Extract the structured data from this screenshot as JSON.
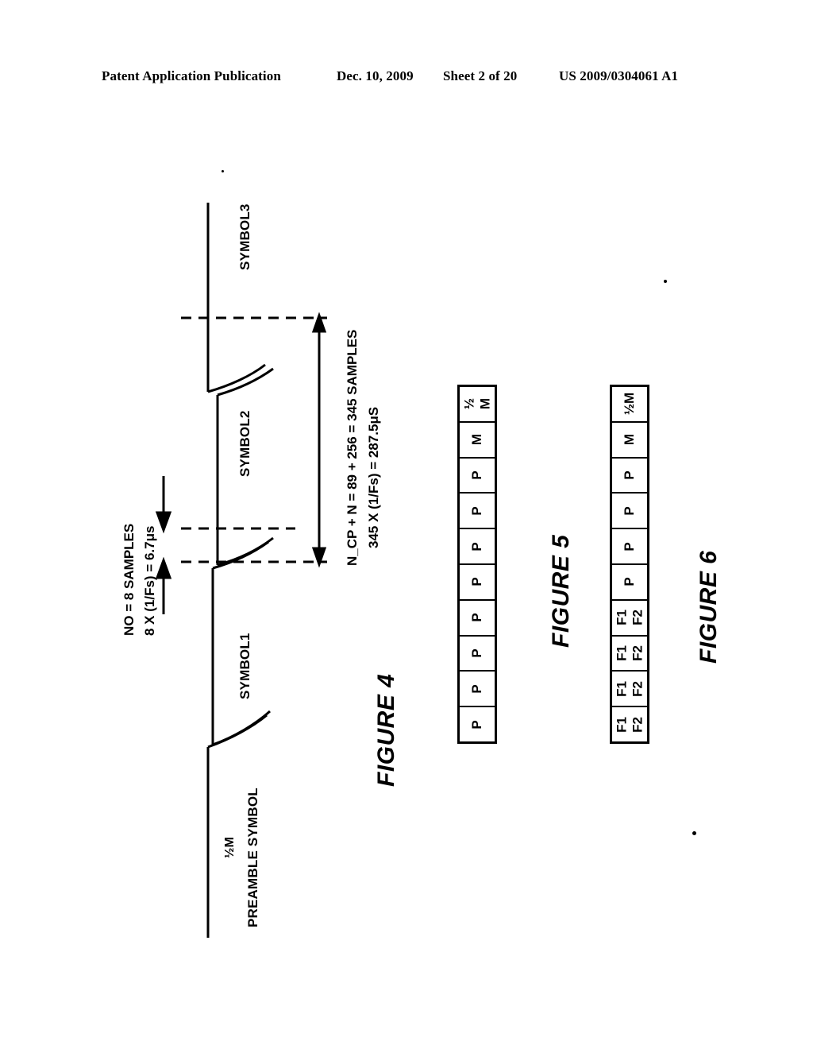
{
  "header": {
    "publication": "Patent Application Publication",
    "date": "Dec. 10, 2009",
    "sheet": "Sheet 2 of 20",
    "patent_number": "US 2009/0304061 A1"
  },
  "figure4": {
    "label": "FIGURE 4",
    "segments": [
      {
        "name": "preamble",
        "label_top": "½M",
        "label_bottom": "PREAMBLE SYMBOL"
      },
      {
        "name": "symbol1",
        "label": "SYMBOL1"
      },
      {
        "name": "symbol2",
        "label": "SYMBOL2"
      },
      {
        "name": "symbol3",
        "label": "SYMBOL3"
      }
    ],
    "guard_annotation": {
      "line1": "NO = 8 SAMPLES",
      "line2": "8 X (1/Fs) = 6.7μs"
    },
    "duration_annotation": {
      "line1": "N_CP + N = 89 + 256 = 345 SAMPLES",
      "line2": "345 X (1/Fs) = 287.5μS"
    }
  },
  "figure5": {
    "label": "FIGURE 5",
    "cells": [
      {
        "lines": [
          "½",
          "M"
        ]
      },
      {
        "lines": [
          "M"
        ]
      },
      {
        "lines": [
          "P"
        ]
      },
      {
        "lines": [
          "P"
        ]
      },
      {
        "lines": [
          "P"
        ]
      },
      {
        "lines": [
          "P"
        ]
      },
      {
        "lines": [
          "P"
        ]
      },
      {
        "lines": [
          "P"
        ]
      },
      {
        "lines": [
          "P"
        ]
      },
      {
        "lines": [
          "P"
        ]
      }
    ]
  },
  "figure6": {
    "label": "FIGURE 6",
    "cells": [
      {
        "lines": [
          "½M"
        ]
      },
      {
        "lines": [
          "M"
        ]
      },
      {
        "lines": [
          "P"
        ]
      },
      {
        "lines": [
          "P"
        ]
      },
      {
        "lines": [
          "P"
        ]
      },
      {
        "lines": [
          "P"
        ]
      },
      {
        "lines": [
          "F1",
          "F2"
        ]
      },
      {
        "lines": [
          "F1",
          "F2"
        ]
      },
      {
        "lines": [
          "F1",
          "F2"
        ]
      },
      {
        "lines": [
          "F1",
          "F2"
        ]
      }
    ]
  },
  "colors": {
    "ink": "#000000",
    "paper": "#ffffff"
  }
}
